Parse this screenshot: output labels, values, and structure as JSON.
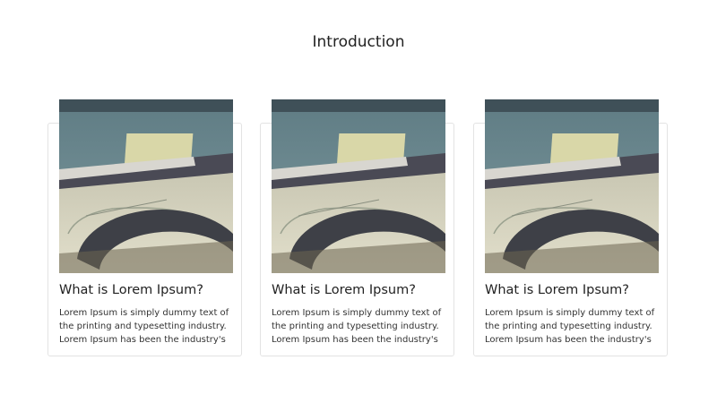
{
  "page": {
    "title": "Introduction"
  },
  "cards": [
    {
      "image_icon": "drafting-desk-photo",
      "title": "What is Lorem Ipsum?",
      "text": "Lorem Ipsum is simply dummy text of the printing and typesetting industry. Lorem Ipsum has been the industry's"
    },
    {
      "image_icon": "drafting-desk-photo",
      "title": "What is Lorem Ipsum?",
      "text": "Lorem Ipsum is simply dummy text of the printing and typesetting industry. Lorem Ipsum has been the industry's"
    },
    {
      "image_icon": "drafting-desk-photo",
      "title": "What is Lorem Ipsum?",
      "text": "Lorem Ipsum is simply dummy text of the printing and typesetting industry. Lorem Ipsum has been the industry's"
    }
  ],
  "colors": {
    "background": "#ffffff",
    "card_border": "#e3e3e3",
    "text": "#212529"
  }
}
